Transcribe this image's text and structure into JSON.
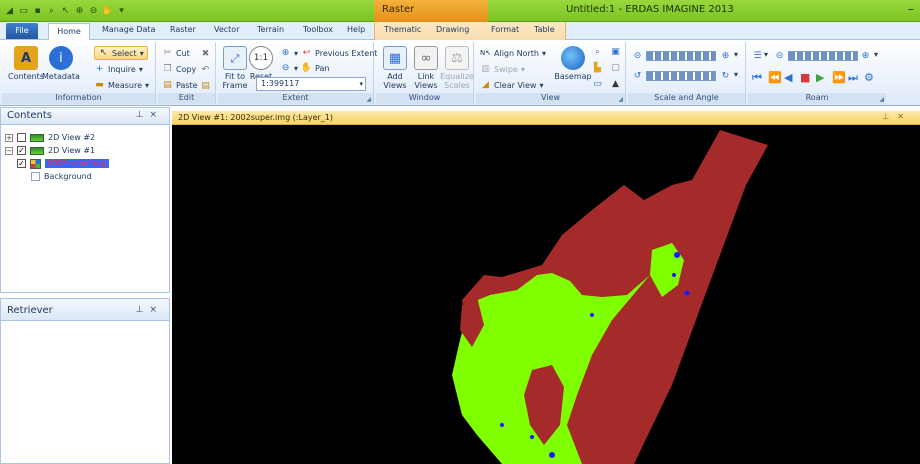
{
  "window": {
    "title": "Untitled:1 - ERDAS IMAGINE 2013",
    "context_tab_title": "Raster"
  },
  "tabs": [
    "File",
    "Home",
    "Manage Data",
    "Raster",
    "Vector",
    "Terrain",
    "Toolbox",
    "Help",
    "Thematic",
    "Drawing",
    "Format",
    "Table"
  ],
  "ribbon": {
    "information": {
      "label": "Information",
      "contents": "Contents",
      "metadata": "Metadata",
      "select": "Select",
      "inquire": "Inquire",
      "measure": "Measure"
    },
    "edit": {
      "label": "Edit",
      "cut": "Cut",
      "copy": "Copy",
      "paste": "Paste"
    },
    "extent": {
      "label": "Extent",
      "fit_to_frame": "Fit to Frame",
      "reset": "Reset",
      "previous_extent": "Previous Extent",
      "pan": "Pan",
      "scale": "1:399117"
    },
    "window": {
      "label": "Window",
      "add_views": "Add Views",
      "link_views": "Link Views",
      "equalize_scales": "Equalize Scales"
    },
    "view": {
      "label": "View",
      "align_north": "Align North",
      "swipe": "Swipe",
      "clear_view": "Clear View",
      "basemap": "Basemap"
    },
    "scale_angle": {
      "label": "Scale and Angle"
    },
    "roam": {
      "label": "Roam"
    }
  },
  "contents_panel": {
    "title": "Contents",
    "items": [
      {
        "label": "2D View #2",
        "checked": false,
        "expanded": false
      },
      {
        "label": "2D View #1",
        "checked": true,
        "expanded": true
      },
      {
        "label": "2002super.img",
        "checked": true
      },
      {
        "label": "Background",
        "checked": false
      }
    ]
  },
  "retriever_panel": {
    "title": "Retriever"
  },
  "view": {
    "title": "2D View #1: 2002super.img (:Layer_1)",
    "colors": {
      "background": "#000000",
      "class_red": "#a52a2a",
      "class_green": "#7fff00",
      "class_blue": "#1a1aff"
    }
  }
}
